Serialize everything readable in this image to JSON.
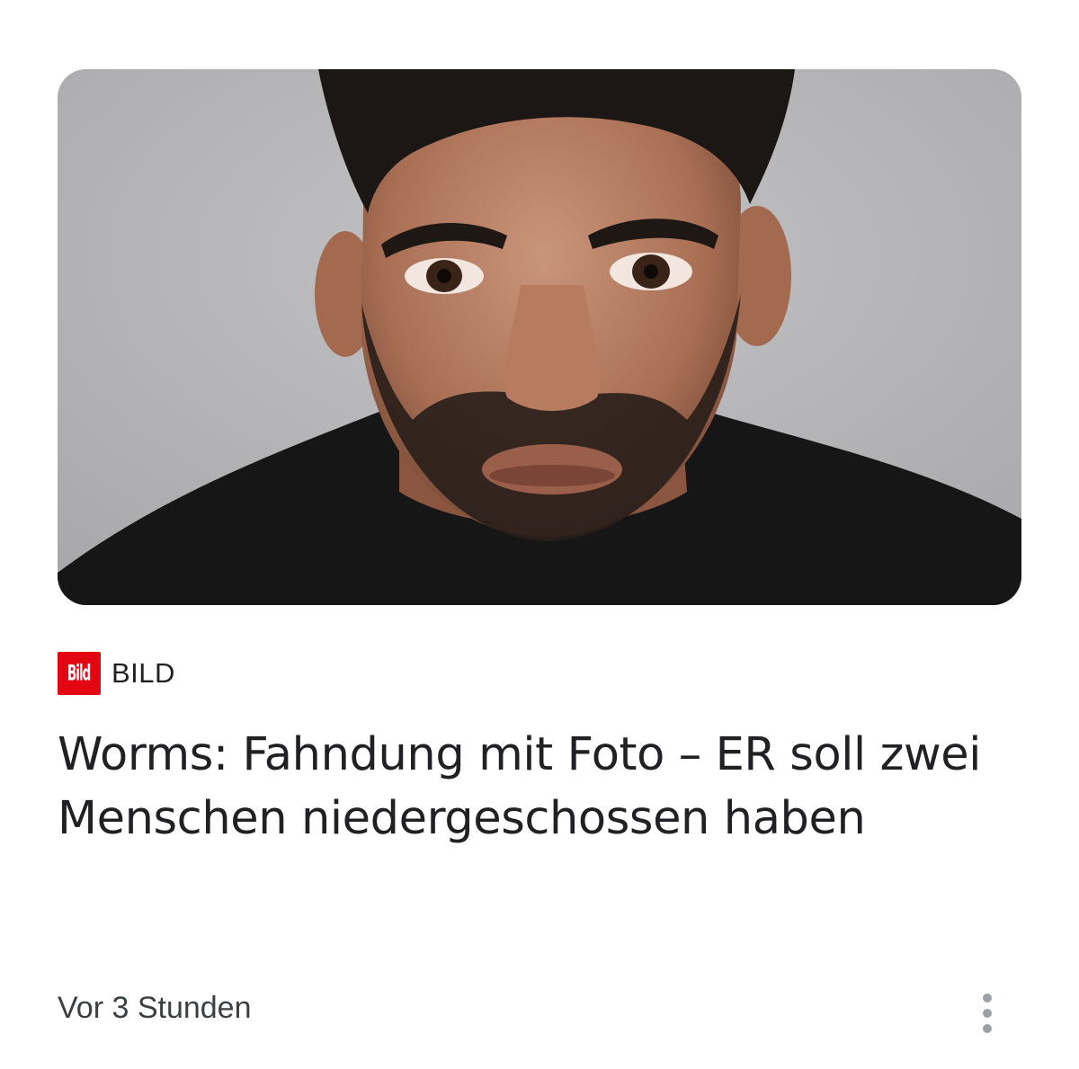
{
  "article": {
    "source_logo_text": "Bild",
    "source_name": "BILD",
    "headline": "Worms: Fahndung mit Foto – ER soll zwei Menschen niedergeschossen haben",
    "time": "Vor 3 Stunden",
    "image_icon": "news-thumbnail-portrait",
    "more_icon": "vertical-dots-icon"
  },
  "colors": {
    "brand_red": "#e30613",
    "text_primary": "#202124",
    "text_secondary": "#3c4043",
    "icon_gray": "#9aa0a6"
  }
}
